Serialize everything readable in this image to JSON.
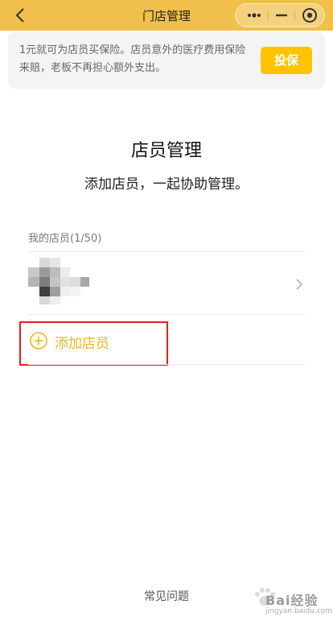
{
  "navbar": {
    "title": "门店管理",
    "bg_color": "#f0bf4c"
  },
  "banner": {
    "text": "1元就可为店员买保险。店员意外的医疗费用保险来赔，老板不再担心额外支出。",
    "button_label": "投保",
    "button_color": "#ffc300"
  },
  "page": {
    "title": "店员管理",
    "subtitle": "添加店员，一起协助管理。"
  },
  "staff": {
    "section_label": "我的店员(1/50)",
    "add_label": "添加店员",
    "accent_color": "#e9b62c"
  },
  "footer": {
    "faq_label": "常见问题",
    "watermark_text": "Bai经验",
    "watermark_sub": "jingyan.baidu.com"
  },
  "icons": {
    "back": "chevron-left-icon",
    "more": "more-dots-icon",
    "minimize": "minimize-icon",
    "close": "target-circle-icon",
    "row_arrow": "chevron-right-icon",
    "add": "plus-circle-icon"
  }
}
